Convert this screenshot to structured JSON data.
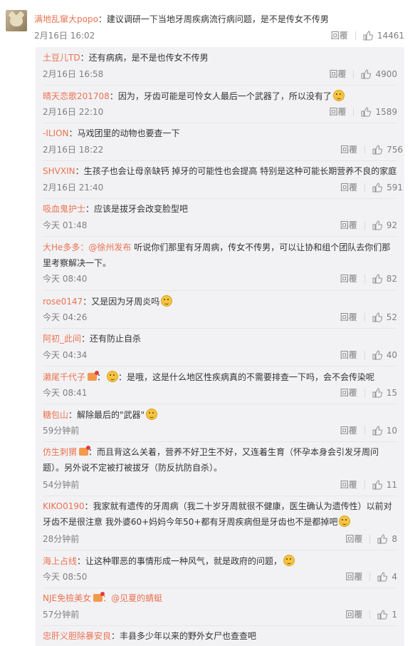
{
  "top_comment": {
    "author": "满地乱窜大popo",
    "text": "：建议调研一下当地牙周疾病流行病问题，是不是传女不传男",
    "time": "2月16日 16:02",
    "reply_label": "回覆",
    "likes": "14461"
  },
  "replies": [
    {
      "author": "土豆儿TD",
      "text": "：还有病病，是不是也传女不传男",
      "time": "2月16日 16:58",
      "reply_label": "回覆",
      "likes": "4900"
    },
    {
      "author": "晴天恋歌201708",
      "text": "：因为，牙齿可能是可怜女人最后一个武器了，所以没有了",
      "emoji": "crying-emoji",
      "time": "2月16日 22:10",
      "reply_label": "回覆",
      "likes": "1589"
    },
    {
      "author": "-ILION",
      "text": "：马戏团里的动物也要查一下",
      "time": "2月16日 18:22",
      "reply_label": "回覆",
      "likes": "756"
    },
    {
      "author": "SHVXIN",
      "text": "：生孩子也会让母亲缺钙 掉牙的可能性也会提高 特别是这种可能长期营养不良的家庭",
      "time": "2月16日 21:40",
      "reply_label": "回覆",
      "likes": "591"
    },
    {
      "author": "吸血鬼护士",
      "text": "：应该是拔牙会改变脸型吧",
      "time": "今天 01:48",
      "reply_label": "回覆",
      "likes": "92"
    },
    {
      "author": "大He多多",
      "mention": "：@徐州发布",
      "text": " 听说你们那里有牙周病，传女不传男，可以让协和组个团队去你们那里考察解决一下。",
      "time": "今天 08:40",
      "reply_label": "回覆",
      "likes": "82"
    },
    {
      "author": "rose0147",
      "text": "：又是因为牙周炎吗",
      "emoji": "shocked-emoji",
      "time": "今天 04:26",
      "reply_label": "回覆",
      "likes": "52"
    },
    {
      "author": "阿初_此间",
      "text": "：还有防止自杀",
      "time": "今天 04:34",
      "reply_label": "回覆",
      "likes": "40"
    },
    {
      "author": "濑尾千代子",
      "text": "：是哦，这是什么地区性疾病真的不需要排查一下吗，会不会传染呢",
      "emoji_before": "shocked-emoji",
      "time": "今天 08:41",
      "reply_label": "回覆",
      "likes": "15"
    },
    {
      "author": "糖包山",
      "text": "：解除最后的\"武器\"",
      "emoji": "sad-emoji",
      "time": "59分钟前",
      "reply_label": "回覆",
      "likes": "10"
    },
    {
      "author": "仿生刺猬",
      "text": "：而且背这么关着，营养不好卫生不好，又连着生育（怀孕本身会引发牙周问题）。另外说不定被打被拔牙（防反抗防自杀）。",
      "time": "54分钟前",
      "reply_label": "回覆",
      "likes": "11"
    },
    {
      "author": "KIKO0190",
      "text": "：我家就有遗传的牙周病（我二十岁牙周就很不健康，医生确认为遗传性）以前对牙齿不是很注意 我外婆60+妈妈今年50+都有牙周疾病但是牙齿也不是都掉吧",
      "emoji": "smile-emoji",
      "time": "28分钟前",
      "reply_label": "回覆",
      "likes": "8"
    },
    {
      "author": "海上占线",
      "text": "：让这种罪恶的事情形成一种风气，就是政府的问题，",
      "emoji": "doge-emoji",
      "time": "今天 08:50",
      "reply_label": "回覆",
      "likes": "4"
    },
    {
      "author": "NJE免檢美女",
      "mention": "：@见夏的蜻蜓",
      "text": "",
      "time": "57分钟前",
      "reply_label": "回覆",
      "likes": "1"
    },
    {
      "author": "忠肝义胆除暴安良",
      "text": "：丰县多少年以来的野外女尸也查查吧"
    }
  ]
}
